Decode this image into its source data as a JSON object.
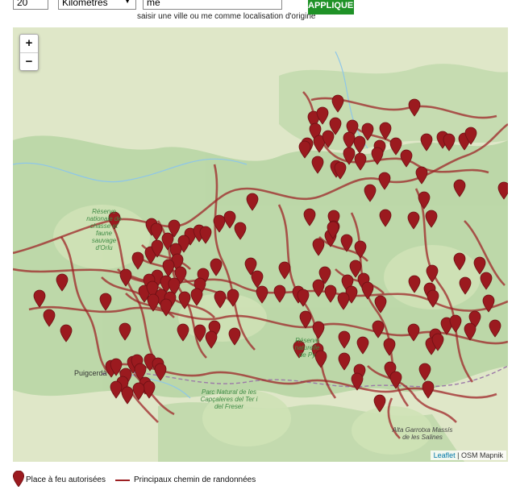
{
  "search": {
    "distance_value": "20",
    "unit_selected": "Kilomètres",
    "origin_value": "me",
    "origin_hint": "saisir une ville ou me comme localisation d'origine",
    "apply_label": "APPLIQUER"
  },
  "map": {
    "zoom_in": "+",
    "zoom_out": "−",
    "attribution_link": "Leaflet",
    "attribution_sep": " | ",
    "attribution_tiles": "OSM Mapnik",
    "place_labels": [
      "Réserve nationale de chasse et faune sauvage d'Orlu",
      "Réserve naturelle de Py",
      "Parc Natural de les Capçaleres del Ter i del Freser",
      "Puigcerdà",
      "Alta Garrotxa Massís de les Salines"
    ],
    "colors": {
      "marker": "#9b1a1f",
      "trail": "#9c1f22",
      "terrain": "#dfe7c8",
      "forest": "#b7d5a3",
      "apply_button": "#1f9227"
    },
    "marker_count": 200
  },
  "legend": {
    "pin_label": "Place à feu autorisées",
    "path_label": "Principaux chemin de randonnées"
  }
}
